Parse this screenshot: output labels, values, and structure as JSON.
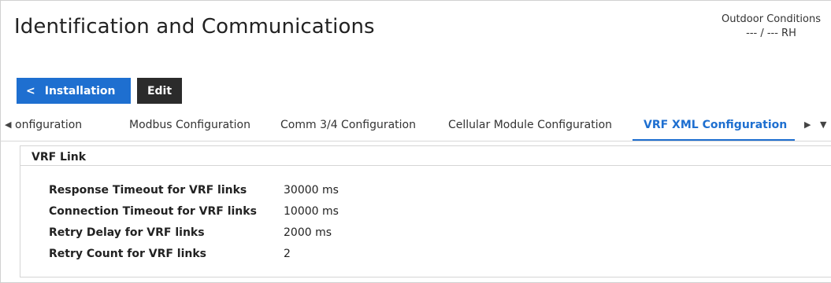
{
  "header": {
    "title": "Identification and Communications",
    "outdoor_label": "Outdoor Conditions",
    "outdoor_value": "--- / --- RH"
  },
  "toolbar": {
    "back_icon": "chevron-left-icon",
    "installation_label": "Installation",
    "edit_label": "Edit"
  },
  "tabs": [
    {
      "label": "onfiguration",
      "active": false
    },
    {
      "label": "Modbus Configuration",
      "active": false
    },
    {
      "label": "Comm 3/4 Configuration",
      "active": false
    },
    {
      "label": "Cellular Module Configuration",
      "active": false
    },
    {
      "label": "VRF XML Configuration",
      "active": true
    }
  ],
  "tab_icons": {
    "scroll_left": "triangle-left-icon",
    "scroll_right": "triangle-right-icon",
    "dropdown": "chevron-down-icon"
  },
  "section": {
    "title": "VRF Link",
    "rows": [
      {
        "label": "Response Timeout for VRF links",
        "value": "30000 ms"
      },
      {
        "label": "Connection Timeout for VRF links",
        "value": "10000 ms"
      },
      {
        "label": "Retry Delay for VRF links",
        "value": "2000 ms"
      },
      {
        "label": "Retry Count for VRF links",
        "value": "2"
      }
    ]
  },
  "colors": {
    "accent": "#1e6fd0",
    "edit_button": "#2b2b2b"
  }
}
